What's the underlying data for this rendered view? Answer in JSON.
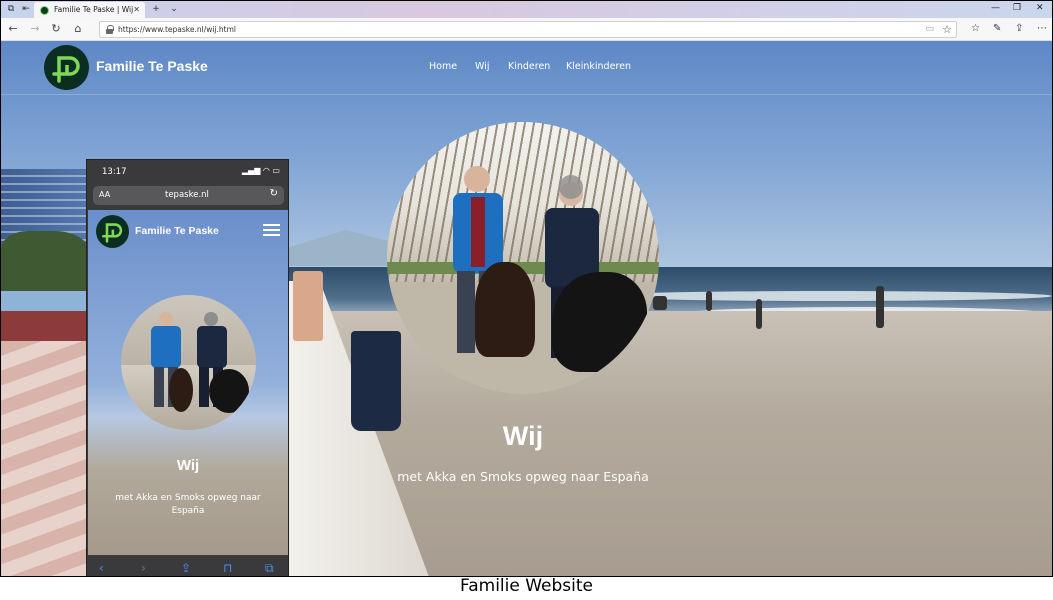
{
  "browser": {
    "tab_title": "Familie Te Paske | Wij",
    "url": "https://www.tepaske.nl/wij.html"
  },
  "site": {
    "brand": "Familie Te Paske",
    "nav": [
      "Home",
      "Wij",
      "Kinderen",
      "Kleinkinderen"
    ]
  },
  "hero": {
    "title": "Wij",
    "subtitle": "met Akka en Smoks opweg naar España"
  },
  "phone": {
    "time": "13:17",
    "text_size_label": "AA",
    "domain": "tepaske.nl",
    "brand": "Familie Te Paske",
    "title": "Wij",
    "subtitle": "met Akka en Smoks opweg naar España"
  },
  "caption": "Familie Website",
  "colors": {
    "logo_bg": "#0c2d22",
    "logo_green": "#7ed957",
    "phone_accent": "#4a8ff2"
  }
}
